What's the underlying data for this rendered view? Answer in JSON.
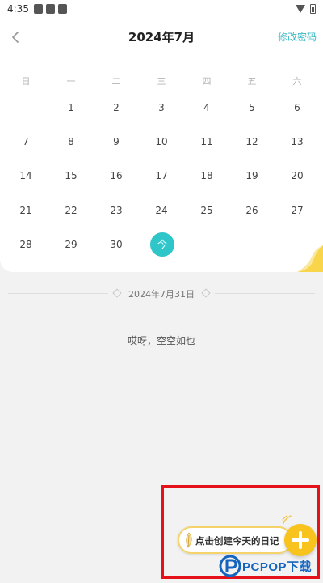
{
  "status_bar": {
    "time": "4:35"
  },
  "header": {
    "title": "2024年7月",
    "change_password_label": "修改密码"
  },
  "calendar": {
    "weekdays": [
      "日",
      "一",
      "二",
      "三",
      "四",
      "五",
      "六"
    ],
    "weeks": [
      [
        "",
        "1",
        "2",
        "3",
        "4",
        "5",
        "6"
      ],
      [
        "7",
        "8",
        "9",
        "10",
        "11",
        "12",
        "13"
      ],
      [
        "14",
        "15",
        "16",
        "17",
        "18",
        "19",
        "20"
      ],
      [
        "21",
        "22",
        "23",
        "24",
        "25",
        "26",
        "27"
      ],
      [
        "28",
        "29",
        "30",
        "",
        "",
        "",
        ""
      ]
    ],
    "today_label": "今"
  },
  "selected_date": {
    "label": "2024年7月31日"
  },
  "diary": {
    "empty_text": "哎呀，空空如也"
  },
  "create": {
    "label": "点击创建今天的日记"
  },
  "watermark": {
    "text": "PCPOP下载"
  },
  "colors": {
    "accent": "#2ec6c9",
    "link": "#3bbac6",
    "add_button": "#f7c31c",
    "highlight": "#e5121a"
  }
}
